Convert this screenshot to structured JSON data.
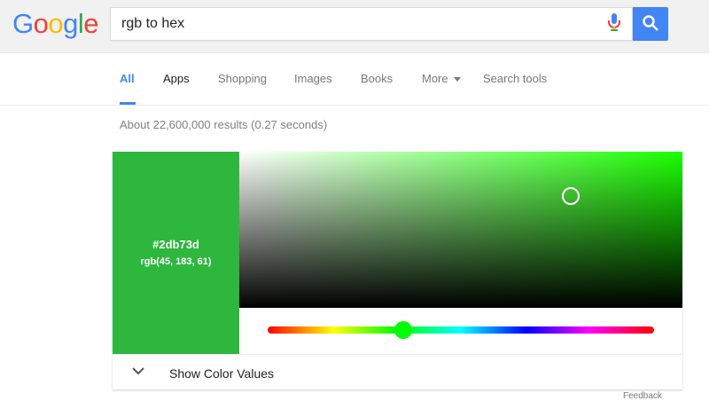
{
  "logo": {
    "letters": [
      "G",
      "o",
      "o",
      "g",
      "l",
      "e"
    ],
    "colors": [
      "#4285f4",
      "#ea4335",
      "#fbbc05",
      "#4285f4",
      "#34a853",
      "#ea4335"
    ]
  },
  "search": {
    "query": "rgb to hex",
    "mic_icon": "mic-icon",
    "search_icon": "search-icon"
  },
  "nav": {
    "items": [
      "All",
      "Apps",
      "Shopping",
      "Images",
      "Books",
      "More",
      "Search tools"
    ],
    "active": "All"
  },
  "result_stats": "About 22,600,000 results (0.27 seconds)",
  "picker": {
    "hex": "#2db73d",
    "rgb": "rgb(45, 183, 61)",
    "swatch_color": "#2db73d",
    "show_values_label": "Show Color Values"
  },
  "feedback": "Feedback"
}
